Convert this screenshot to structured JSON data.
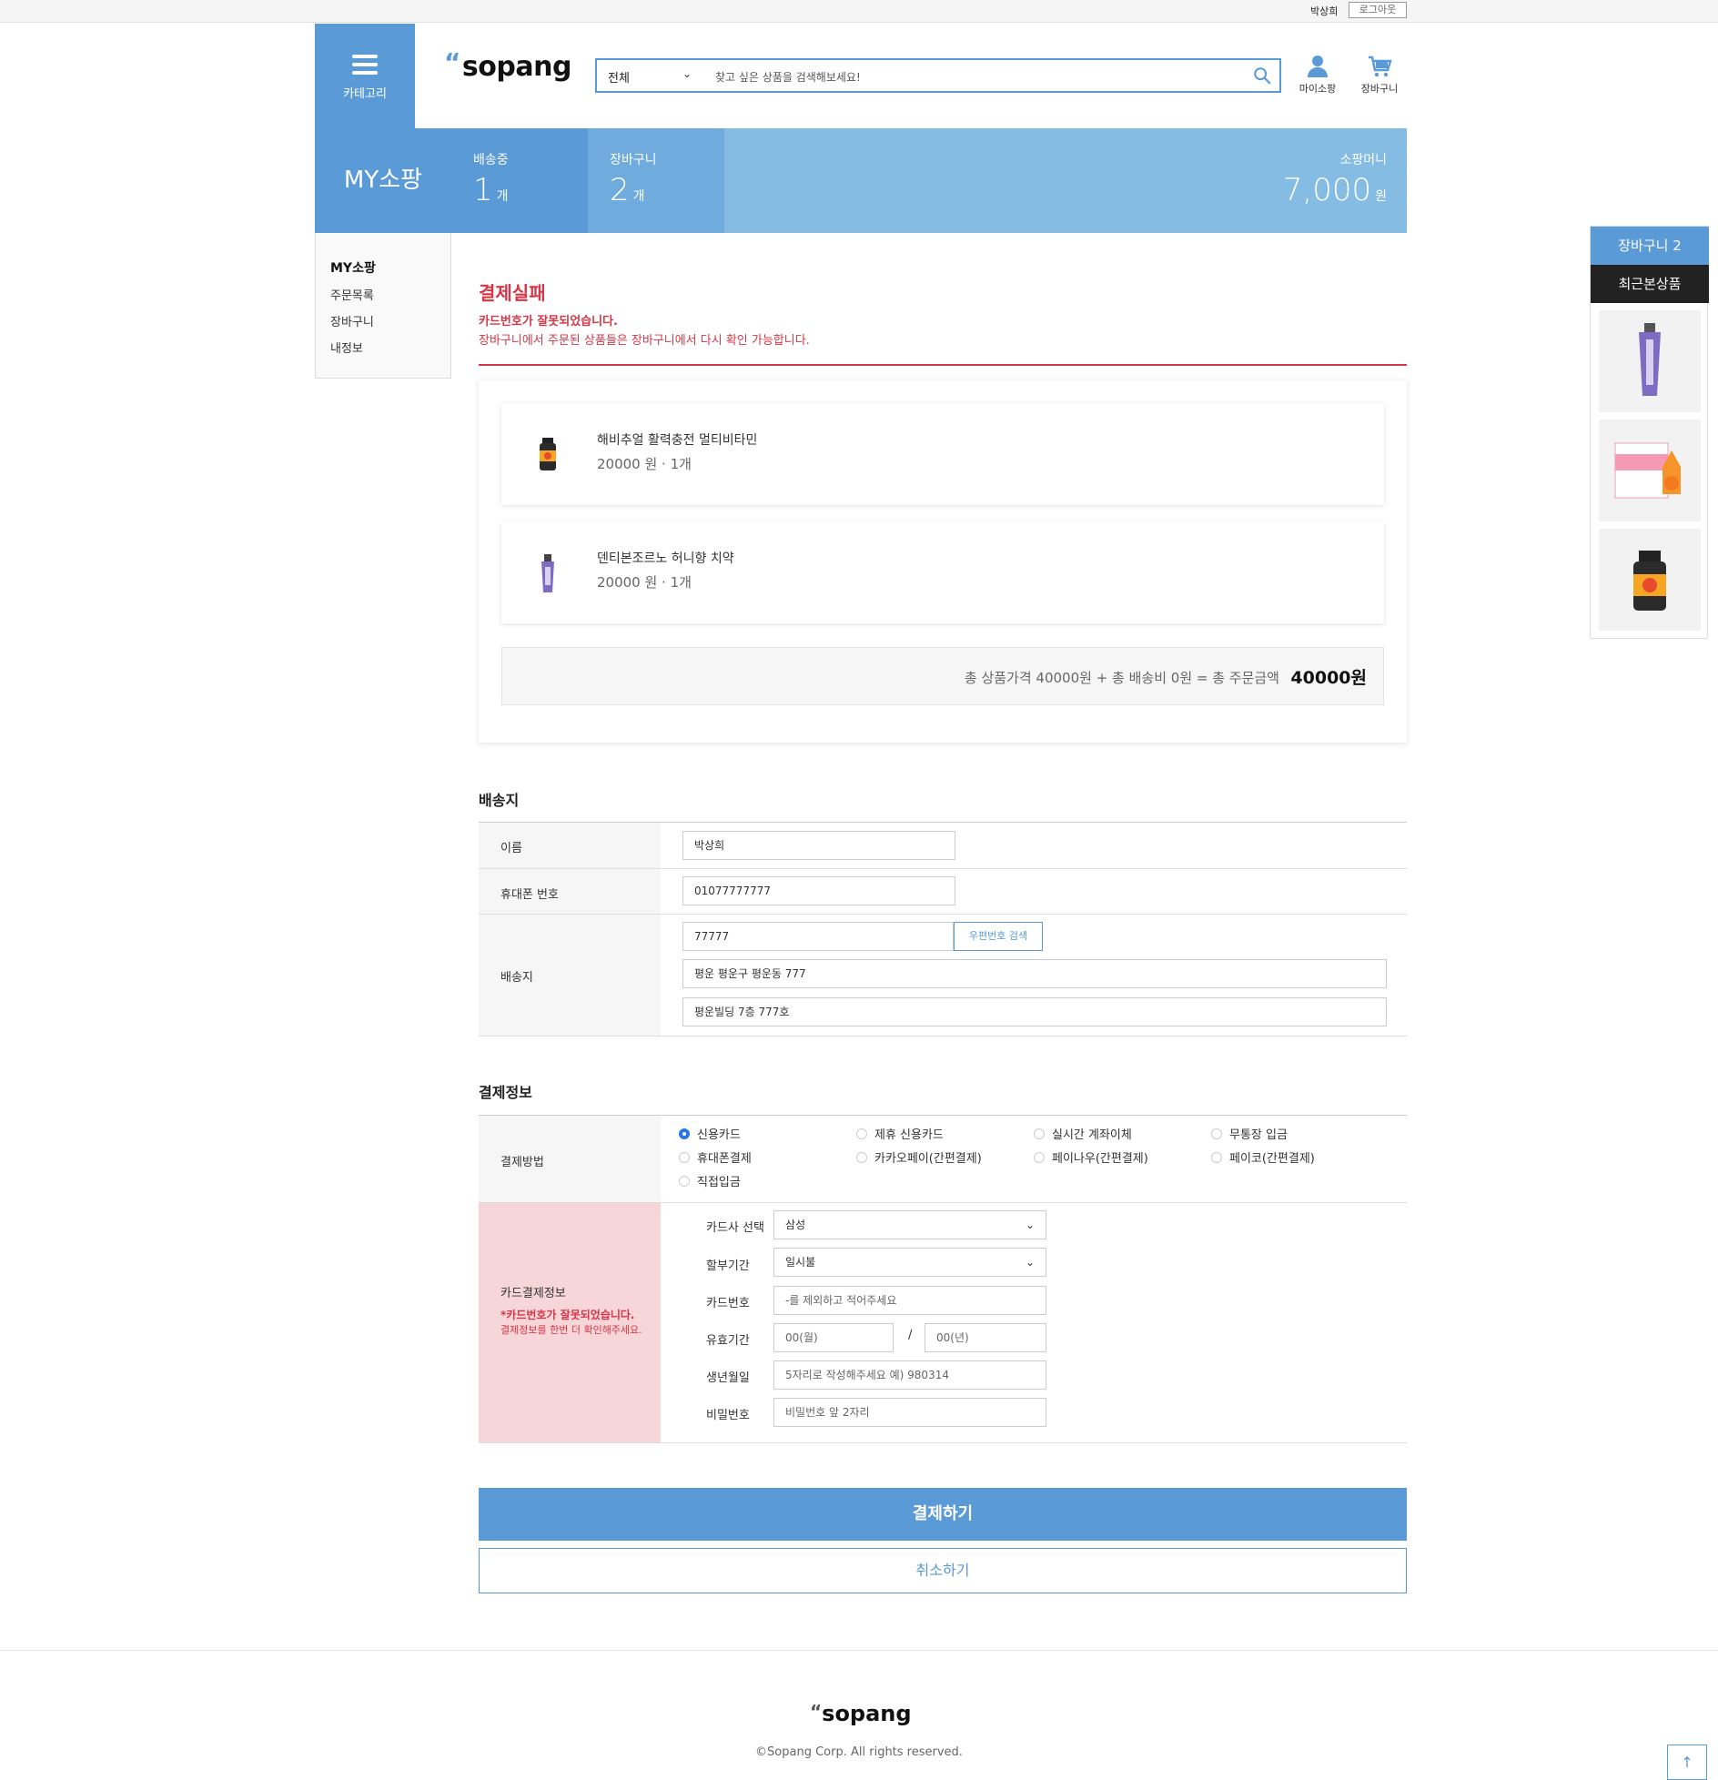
{
  "topbar": {
    "user_name": "박상희",
    "logout_label": "로그아웃"
  },
  "header": {
    "category_label": "카테고리",
    "logo": "sopang",
    "search_category": "전체",
    "search_placeholder": "찾고 싶은 상품을 검색해보세요!",
    "mypage_label": "마이소팡",
    "cart_label": "장바구니"
  },
  "summary": {
    "title": "MY소팡",
    "shipping_label": "배송중",
    "shipping_count": "1",
    "cart_label": "장바구니",
    "cart_count": "2",
    "money_label": "소팡머니",
    "money_value": "7,000",
    "unit_count": "개",
    "unit_won": "원"
  },
  "sidebar": {
    "heading": "MY소팡",
    "items": [
      "주문목록",
      "장바구니",
      "내정보"
    ]
  },
  "failure": {
    "title": "결제실패",
    "message": "카드번호가 잘못되었습니다.",
    "note": "장바구니에서 주문된 상품들은 장바구니에서 다시 확인 가능합니다."
  },
  "products": [
    {
      "name": "해비추얼 활력충전 멀티비타민",
      "price": "20000 원 · 1개"
    },
    {
      "name": "덴티본조르노 허니향 치약",
      "price": "20000 원 · 1개"
    }
  ],
  "total": {
    "text": "총 상품가격 40000원 + 총 배송비 0원 = 총 주문금액",
    "amount": "40000원"
  },
  "shipping": {
    "section_title": "배송지",
    "name_label": "이름",
    "name_value": "박상희",
    "phone_label": "휴대폰 번호",
    "phone_value": "01077777777",
    "address_label": "배송지",
    "zip_value": "77777",
    "zip_button": "우편번호 검색",
    "address1": "평운 평운구 평운동 777",
    "address2": "평운빌딩 7층 777호"
  },
  "payment": {
    "section_title": "결제정보",
    "method_label": "결제방법",
    "methods": [
      "신용카드",
      "제휴 신용카드",
      "실시간 계좌이체",
      "무통장 입금",
      "휴대폰결제",
      "카카오페이(간편결제)",
      "페이나우(간편결제)",
      "페이코(간편결제)",
      "직접입금"
    ],
    "selected_method": "신용카드",
    "card_info_label": "카드결제정보",
    "card_error": "*카드번호가 잘못되었습니다.",
    "card_error_note": "결제정보를 한번 더 확인해주세요.",
    "card_company_label": "카드사 선택",
    "card_company_value": "삼성",
    "installment_label": "할부기간",
    "installment_value": "일시불",
    "card_number_label": "카드번호",
    "card_number_placeholder": "-를 제외하고 적어주세요",
    "expiry_label": "유효기간",
    "expiry_month_placeholder": "00(월)",
    "expiry_year_placeholder": "00(년)",
    "expiry_sep": "/",
    "birth_label": "생년월일",
    "birth_placeholder": "5자리로 작성해주세요 예) 980314",
    "password_label": "비밀번호",
    "password_placeholder": "비밀번호 앞 2자리"
  },
  "buttons": {
    "pay": "결제하기",
    "cancel": "취소하기"
  },
  "float_panel": {
    "cart_label": "장바구니 2",
    "recent_label": "최근본상품"
  },
  "footer": {
    "logo": "sopang",
    "copyright": "©Sopang Corp. All rights reserved."
  },
  "colors": {
    "primary": "#5a9ad6",
    "light_blue": "#85bce3",
    "error_red": "#d63645",
    "error_bg": "#f7d6da"
  }
}
